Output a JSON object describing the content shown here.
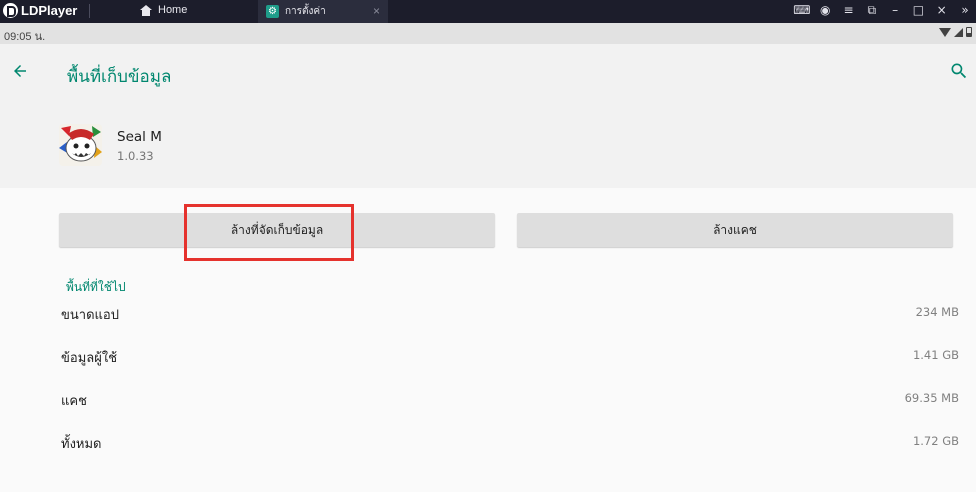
{
  "emulator": {
    "brand": "LDPlayer",
    "tabs": [
      {
        "label": "Home"
      },
      {
        "label": "การตั้งค่า"
      }
    ],
    "tab_close_glyph": "×",
    "window_controls": [
      {
        "icon": "gamepad-icon",
        "glyph": "⌨"
      },
      {
        "icon": "account-icon",
        "glyph": "◉"
      },
      {
        "icon": "menu-icon",
        "glyph": "≡"
      },
      {
        "icon": "restore-view-icon",
        "glyph": "⧉"
      },
      {
        "icon": "minimize-icon",
        "glyph": "–"
      },
      {
        "icon": "maximize-icon",
        "glyph": "□"
      },
      {
        "icon": "close-icon",
        "glyph": "×"
      },
      {
        "icon": "sidebar-expand-icon",
        "glyph": "»"
      }
    ]
  },
  "statusbar": {
    "time": "09:05 น."
  },
  "appbar": {
    "title": "พื้นที่เก็บข้อมูล"
  },
  "app": {
    "name": "Seal M",
    "version": "1.0.33"
  },
  "actions": {
    "clear_storage": "ล้างที่จัดเก็บข้อมูล",
    "clear_cache": "ล้างแคช"
  },
  "storage": {
    "section_title": "พื้นที่ที่ใช้ไป",
    "rows": [
      {
        "label": "ขนาดแอป",
        "value": "234 MB"
      },
      {
        "label": "ข้อมูลผู้ใช้",
        "value": "1.41 GB"
      },
      {
        "label": "แคช",
        "value": "69.35 MB"
      },
      {
        "label": "ทั้งหมด",
        "value": "1.72 GB"
      }
    ]
  },
  "colors": {
    "accent": "#01876f",
    "highlight": "#e5322d",
    "emulator_bar": "#1c1d2b"
  }
}
